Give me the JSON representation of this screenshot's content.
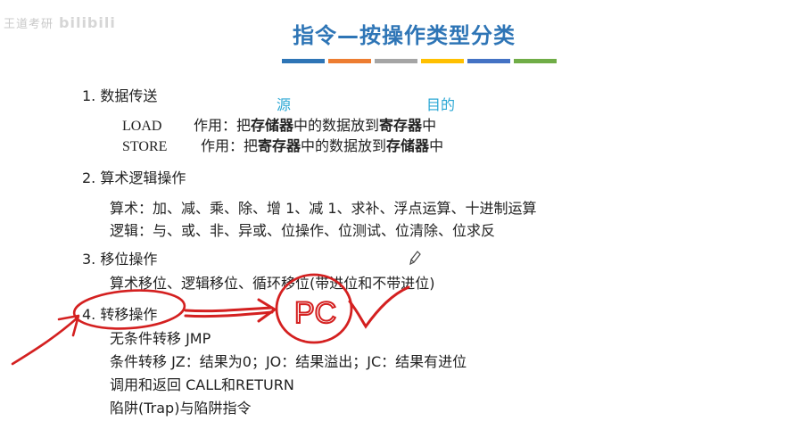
{
  "watermark": {
    "text": "王道考研",
    "brand": "bilibili"
  },
  "title": "指令—按操作类型分类",
  "title_bar_colors": [
    "#2e75b6",
    "#ed7d31",
    "#a5a5a5",
    "#ffc000",
    "#4472c4",
    "#70ad47"
  ],
  "annotations": {
    "src_label": "源",
    "dst_label": "目的",
    "pc_text": "PC"
  },
  "sections": {
    "s1": {
      "heading": "1. 数据传送",
      "load": {
        "op": "LOAD",
        "pre": "作用：把",
        "b1": "存储器",
        "mid": "中的数据放到",
        "b2": "寄存器",
        "post": "中"
      },
      "store": {
        "op": "STORE",
        "pre": "作用：把",
        "b1": "寄存器",
        "mid": "中的数据放到",
        "b2": "存储器",
        "post": "中"
      }
    },
    "s2": {
      "heading": "2. 算术逻辑操作",
      "arith": "算术：加、减、乘、除、增 1、减 1、求补、浮点运算、十进制运算",
      "logic": "逻辑：与、或、非、异或、位操作、位测试、位清除、位求反"
    },
    "s3": {
      "heading": "3. 移位操作",
      "line": "算术移位、逻辑移位、循环移位(带进位和不带进位)"
    },
    "s4": {
      "heading": "4. 转移操作",
      "jmp": "无条件转移  JMP",
      "cond": "条件转移     JZ：结果为0；JO：结果溢出；JC：结果有进位",
      "call": "调用和返回  CALL和RETURN",
      "trap": "陷阱(Trap)与陷阱指令"
    }
  }
}
